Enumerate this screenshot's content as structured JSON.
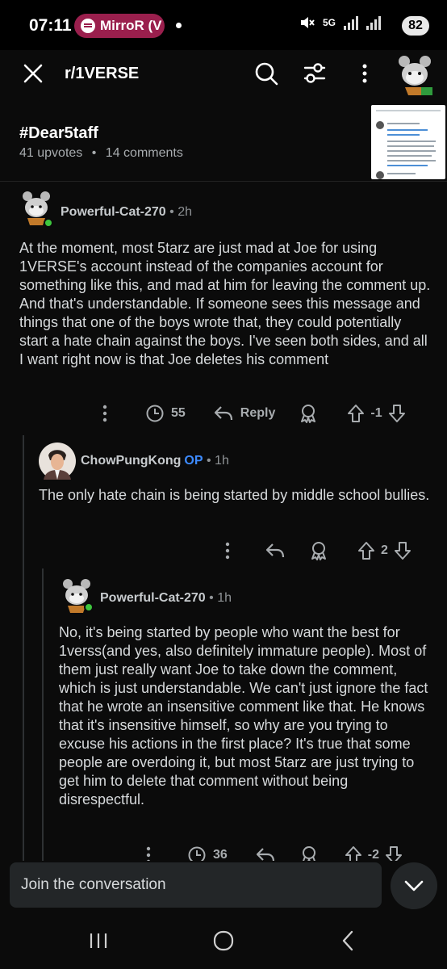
{
  "status_bar": {
    "time": "07:11",
    "media_app": "MirroR (V",
    "network": "5G",
    "battery": "82"
  },
  "app_bar": {
    "subreddit": "r/1VERSE"
  },
  "post": {
    "title": "#Dear5taff",
    "upvotes": "41 upvotes",
    "separator": "•",
    "comments": "14 comments"
  },
  "comments": [
    {
      "author": "Powerful-Cat-270",
      "age": " • 2h",
      "body": "At the moment, most 5tarz are just mad at Joe for using 1VERSE's account instead of the companies account for something like this, and mad at him for leaving the comment up. And that's understandable. If someone sees this message and things that one of the boys wrote that, they could potentially start a hate chain against the boys. I've seen both sides, and all I want right now is that Joe deletes his comment",
      "awards": "55",
      "reply_label": "Reply",
      "score": "-1"
    },
    {
      "author": "ChowPungKong",
      "op_badge": "OP",
      "age": " • 1h",
      "body": "The only hate chain is being started by middle school bullies.",
      "score": "2"
    },
    {
      "author": "Powerful-Cat-270",
      "age": " • 1h",
      "body": "No, it's being started by people who want the best for 1verss(and yes, also definitely immature people). Most of them just really want Joe to take down the comment, which is just understandable. We can't just ignore the fact that he wrote an insensitive comment like that. He knows that it's insensitive himself, so why are you trying to excuse his actions in the first place? It's true that some people are overdoing it, but most 5tarz are just trying to get him to delete that comment without being disrespectful.",
      "awards": "36",
      "score": "-2"
    }
  ],
  "composer": {
    "placeholder": "Join the conversation"
  },
  "colors": {
    "accent": "#3d8bff",
    "online": "#3ec63e",
    "pill": "#9a1f4d"
  }
}
